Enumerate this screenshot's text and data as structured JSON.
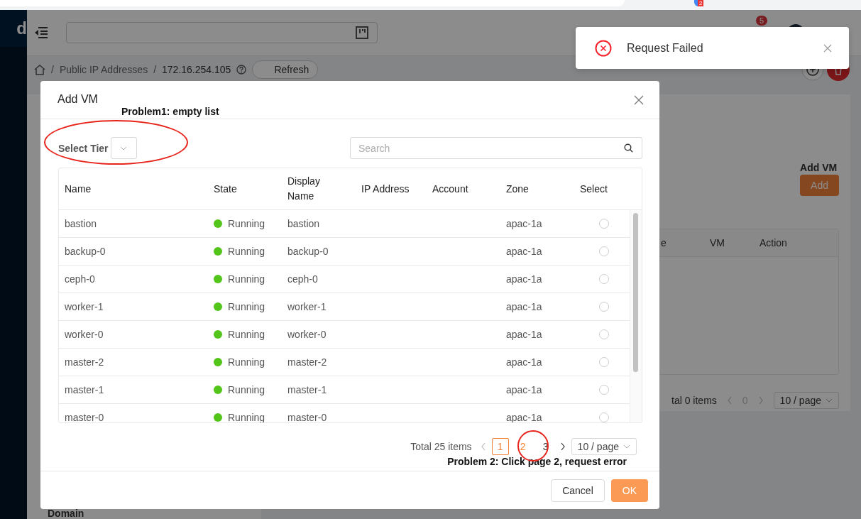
{
  "browser": {
    "extension_badge": "2"
  },
  "sidebar": {
    "logo": "d"
  },
  "header": {
    "notification_count": "5"
  },
  "breadcrumb": {
    "separators": [
      "/",
      "/"
    ],
    "items": [
      "Public IP Addresses",
      "172.16.254.105"
    ],
    "refresh": "Refresh"
  },
  "background_panel": {
    "add_label": "Add VM",
    "add_button": "Add",
    "columns": [
      "e",
      "VM",
      "Action"
    ],
    "total": "tal 0 items",
    "page": "0",
    "page_size": "10 / page",
    "section": "Domain"
  },
  "modal": {
    "title": "Add VM",
    "tier": {
      "label": "Select Tier",
      "circled": true
    },
    "search": {
      "placeholder": "Search"
    },
    "columns": [
      "Name",
      "State",
      "Display Name",
      "IP Address",
      "Account",
      "Zone",
      "Select"
    ],
    "rows": [
      {
        "name": "bastion",
        "state": "Running",
        "color": "#52c41a",
        "display_name": "bastion",
        "zone": "apac-1a",
        "selected": false
      },
      {
        "name": "backup-0",
        "state": "Running",
        "color": "#52c41a",
        "display_name": "backup-0",
        "zone": "apac-1a",
        "selected": false
      },
      {
        "name": "ceph-0",
        "state": "Running",
        "color": "#52c41a",
        "display_name": "ceph-0",
        "zone": "apac-1a",
        "selected": false
      },
      {
        "name": "worker-1",
        "state": "Running",
        "color": "#52c41a",
        "display_name": "worker-1",
        "zone": "apac-1a",
        "selected": false
      },
      {
        "name": "worker-0",
        "state": "Running",
        "color": "#52c41a",
        "display_name": "worker-0",
        "zone": "apac-1a",
        "selected": false
      },
      {
        "name": "master-2",
        "state": "Running",
        "color": "#52c41a",
        "display_name": "master-2",
        "zone": "apac-1a",
        "selected": false
      },
      {
        "name": "master-1",
        "state": "Running",
        "color": "#52c41a",
        "display_name": "master-1",
        "zone": "apac-1a",
        "selected": false
      },
      {
        "name": "master-0",
        "state": "Running",
        "color": "#52c41a",
        "display_name": "master-0",
        "zone": "apac-1a",
        "selected": false
      }
    ],
    "pagination": {
      "total": "Total 25 items",
      "pages": [
        {
          "label": "1",
          "selected": true,
          "hovered": false,
          "circled": false
        },
        {
          "label": "2",
          "selected": false,
          "hovered": true,
          "circled": true
        },
        {
          "label": "3",
          "selected": false,
          "hovered": false,
          "circled": false
        }
      ],
      "page_size": "10 / page"
    },
    "buttons": {
      "cancel": "Cancel",
      "ok": "OK"
    }
  },
  "toast": {
    "message": "Request Failed"
  },
  "annotations": {
    "tier_note": "Problem1: empty list",
    "pagination_note": "Problem 2: Click page 2, request error"
  }
}
